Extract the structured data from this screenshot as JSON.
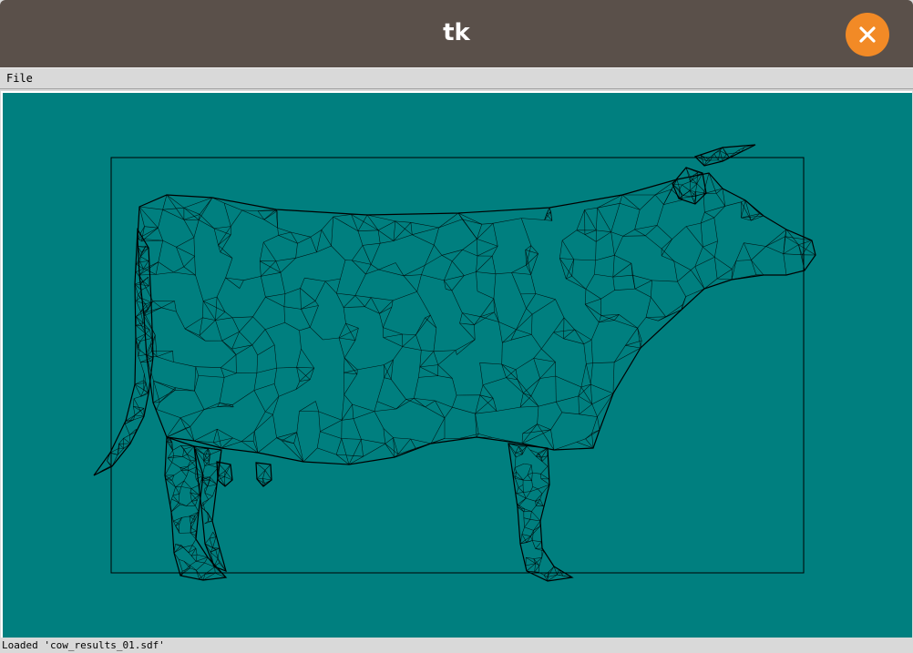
{
  "window": {
    "title": "tk",
    "close_icon": "close-icon",
    "titlebar_color": "#5a504a",
    "close_color": "#f28a26"
  },
  "menubar": {
    "items": [
      {
        "label": "File"
      }
    ]
  },
  "canvas": {
    "background": "#007f7f",
    "content": "wireframe cow mesh with bounding box",
    "line_color": "#000000"
  },
  "status": {
    "text": "Loaded 'cow_results_01.sdf'"
  }
}
